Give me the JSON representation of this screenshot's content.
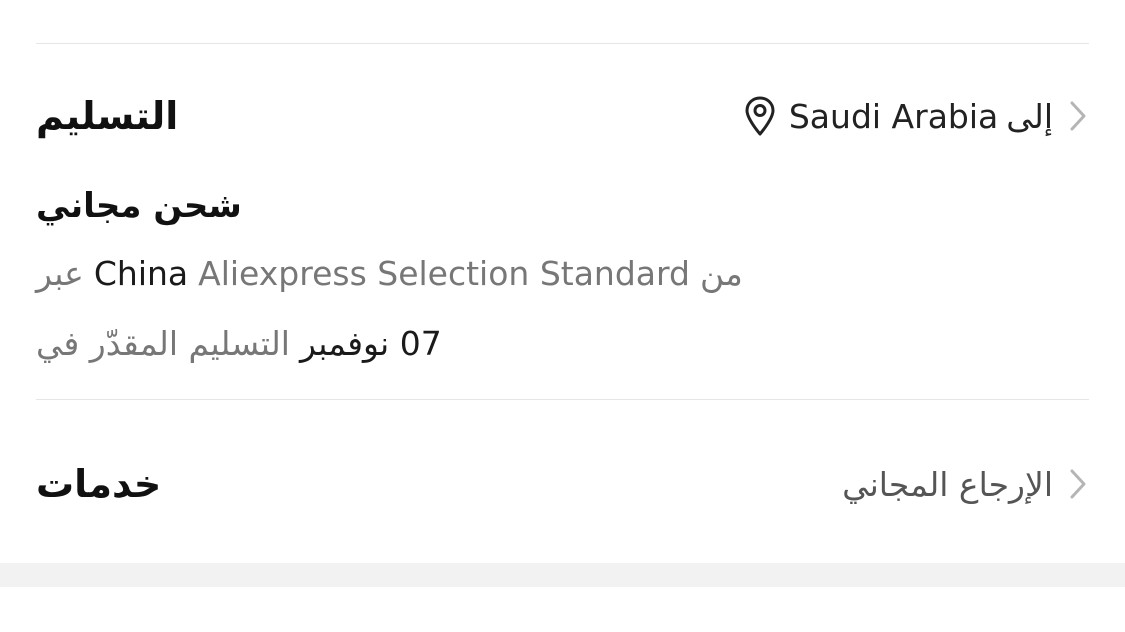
{
  "delivery": {
    "title": "التسليم",
    "to_prefix": "إلى",
    "country": "Saudi Arabia",
    "shipping_title": "شحن مجاني",
    "via_prefix": "من",
    "carrier": "Aliexpress Selection Standard",
    "origin": "China",
    "via_suffix": "عبر",
    "estimate_prefix": "التسليم المقدّر في",
    "estimate_date": "07 نوفمبر"
  },
  "services": {
    "title": "خدمات",
    "value": "الإرجاع المجاني"
  },
  "colors": {
    "divider": "#e6e6e6",
    "muted_text": "#777777",
    "chevron": "#b5b5b5",
    "band": "#f2f2f2"
  },
  "icons": {
    "chevron": "chevron-right-icon",
    "location": "location-pin-icon"
  }
}
